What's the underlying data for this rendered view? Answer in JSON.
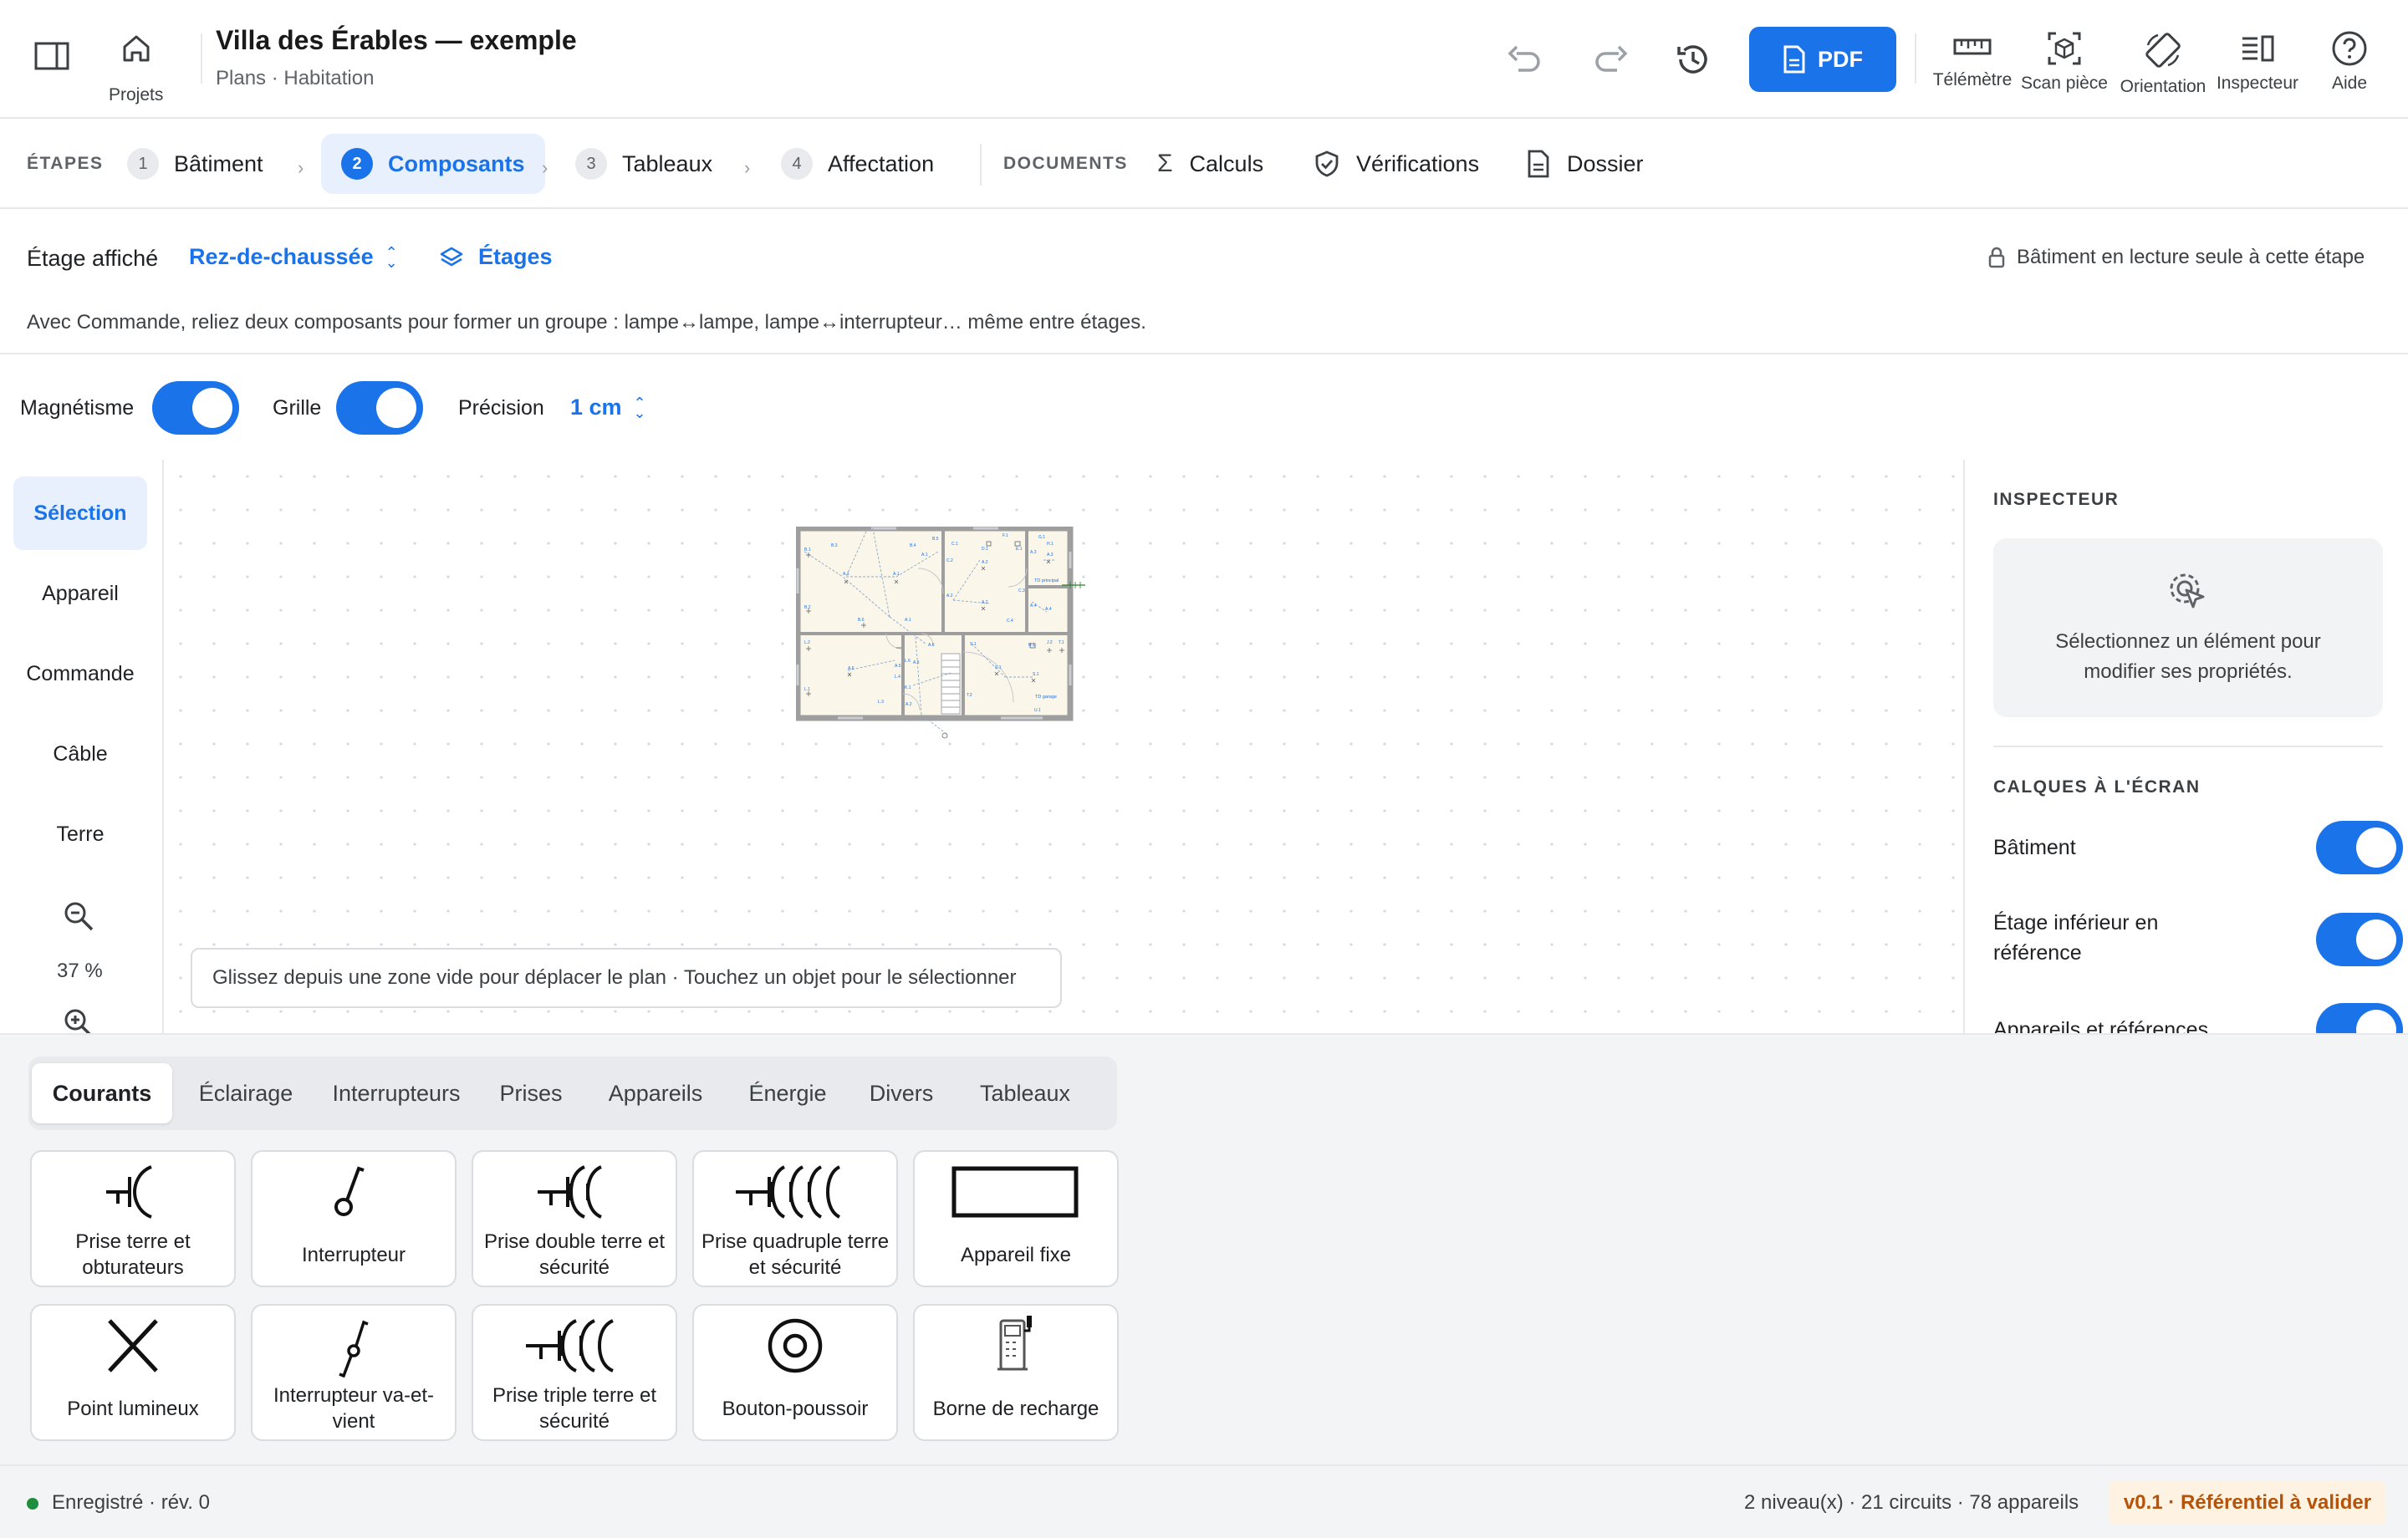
{
  "header": {
    "projects_label": "Projets",
    "title": "Villa des Érables — exemple",
    "subtitle": "Plans · Habitation",
    "pdf_label": "PDF",
    "tools": [
      "Télémètre",
      "Scan pièce",
      "Orientation",
      "Inspecteur",
      "Aide"
    ]
  },
  "steps": {
    "section_label": "ÉTAPES",
    "items": [
      {
        "num": "1",
        "label": "Bâtiment"
      },
      {
        "num": "2",
        "label": "Composants"
      },
      {
        "num": "3",
        "label": "Tableaux"
      },
      {
        "num": "4",
        "label": "Affectation"
      }
    ],
    "documents_label": "DOCUMENTS",
    "documents": [
      "Calculs",
      "Vérifications",
      "Dossier"
    ]
  },
  "floor": {
    "label": "Étage affiché",
    "value": "Rez-de-chaussée",
    "floors_link": "Étages",
    "readonly_note": "Bâtiment en lecture seule à cette étape",
    "help_text": "Avec Commande, reliez deux composants pour former un groupe : lampe↔lampe, lampe↔interrupteur… même entre étages."
  },
  "options": {
    "magnetism_label": "Magnétisme",
    "grid_label": "Grille",
    "precision_label": "Précision",
    "precision_value": "1 cm"
  },
  "tools": [
    "Sélection",
    "Appareil",
    "Commande",
    "Câble",
    "Terre"
  ],
  "zoom": "37 %",
  "canvas_hint": "Glissez depuis une zone vide pour déplacer le plan · Touchez un objet pour le sélectionner",
  "plan_labels": {
    "panel_main": "TD principal",
    "panel_garage": "TD garage"
  },
  "inspector": {
    "title": "INSPECTEUR",
    "empty_text": "Sélectionnez un élément pour modifier ses propriétés.",
    "layers_title": "CALQUES À L'ÉCRAN",
    "layers": [
      "Bâtiment",
      "Étage inférieur en référence",
      "Appareils et références"
    ]
  },
  "palette": {
    "tabs": [
      "Courants",
      "Éclairage",
      "Interrupteurs",
      "Prises",
      "Appareils",
      "Énergie",
      "Divers",
      "Tableaux"
    ],
    "items": [
      {
        "label": "Prise terre et obturateurs",
        "icon": "outlet-ground-icon"
      },
      {
        "label": "Interrupteur",
        "icon": "switch-icon"
      },
      {
        "label": "Prise double terre et sécurité",
        "icon": "outlet-double-icon"
      },
      {
        "label": "Prise quadruple terre et sécurité",
        "icon": "outlet-quadruple-icon"
      },
      {
        "label": "Appareil fixe",
        "icon": "fixed-appliance-icon"
      },
      {
        "label": "Point lumineux",
        "icon": "light-point-icon"
      },
      {
        "label": "Interrupteur va-et-vient",
        "icon": "two-way-switch-icon"
      },
      {
        "label": "Prise triple terre et sécurité",
        "icon": "outlet-triple-icon"
      },
      {
        "label": "Bouton-poussoir",
        "icon": "push-button-icon"
      },
      {
        "label": "Borne de recharge",
        "icon": "charging-station-icon"
      }
    ]
  },
  "status": {
    "saved": "Enregistré · rév. 0",
    "summary": "2 niveau(x) · 21 circuits · 78 appareils",
    "badge": "v0.1 · Référentiel à valider"
  },
  "colors": {
    "accent": "#1a73e8",
    "saved_dot": "#1e8e3e",
    "badge_text": "#b45309",
    "badge_bg": "#fef3e2"
  }
}
